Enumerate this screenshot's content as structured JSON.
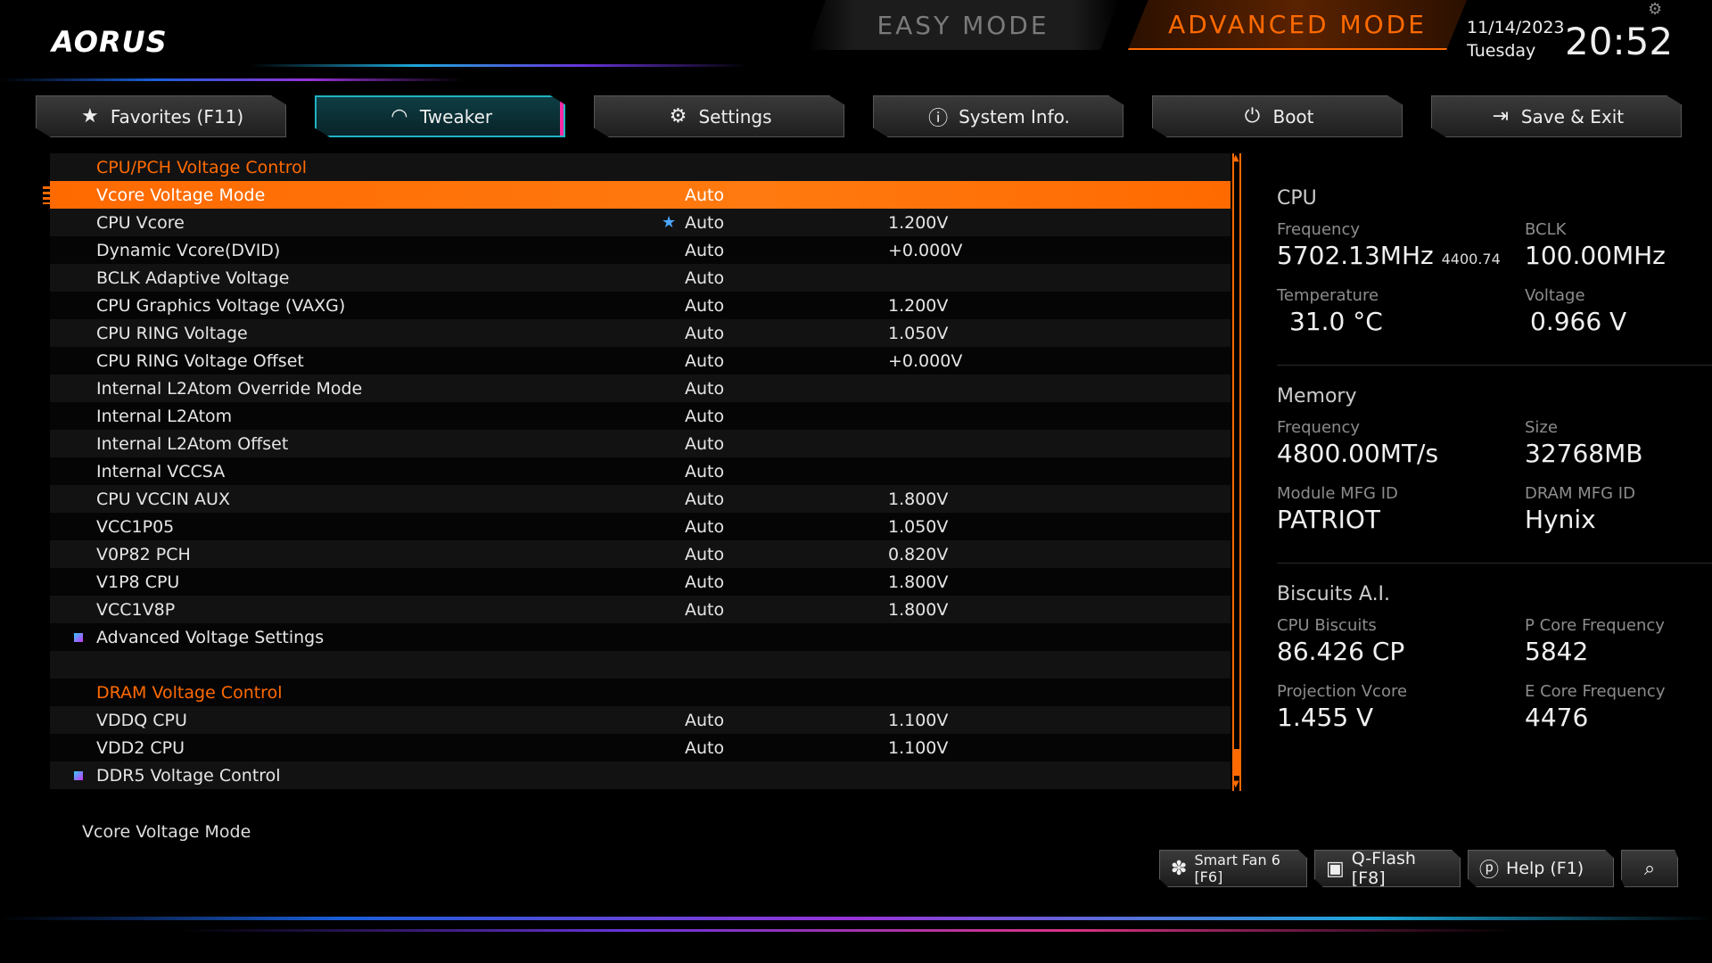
{
  "header": {
    "logo": "AORUS",
    "easy_mode": "EASY MODE",
    "advanced_mode": "ADVANCED MODE",
    "date": "11/14/2023",
    "day": "Tuesday",
    "time": "20:52"
  },
  "tabs": [
    {
      "label": "Favorites (F11)",
      "icon": "star-icon"
    },
    {
      "label": "Tweaker",
      "icon": "speedometer-icon"
    },
    {
      "label": "Settings",
      "icon": "gear-icon"
    },
    {
      "label": "System Info.",
      "icon": "info-icon"
    },
    {
      "label": "Boot",
      "icon": "power-icon"
    },
    {
      "label": "Save & Exit",
      "icon": "exit-icon"
    }
  ],
  "rows": [
    {
      "name": "CPU/PCH Voltage Control",
      "val1": "",
      "val2": ""
    },
    {
      "name": "Vcore Voltage Mode",
      "val1": "Auto",
      "val2": ""
    },
    {
      "name": "CPU Vcore",
      "val1": "Auto",
      "val2": "1.200V"
    },
    {
      "name": "Dynamic Vcore(DVID)",
      "val1": "Auto",
      "val2": "+0.000V"
    },
    {
      "name": "BCLK Adaptive Voltage",
      "val1": "Auto",
      "val2": ""
    },
    {
      "name": "CPU Graphics Voltage (VAXG)",
      "val1": "Auto",
      "val2": "1.200V"
    },
    {
      "name": "CPU RING Voltage",
      "val1": "Auto",
      "val2": "1.050V"
    },
    {
      "name": "CPU RING Voltage Offset",
      "val1": "Auto",
      "val2": "+0.000V"
    },
    {
      "name": "Internal L2Atom Override Mode",
      "val1": "Auto",
      "val2": ""
    },
    {
      "name": "Internal L2Atom",
      "val1": "Auto",
      "val2": ""
    },
    {
      "name": "Internal L2Atom Offset",
      "val1": "Auto",
      "val2": ""
    },
    {
      "name": "Internal VCCSA",
      "val1": "Auto",
      "val2": ""
    },
    {
      "name": "CPU VCCIN AUX",
      "val1": "Auto",
      "val2": "1.800V"
    },
    {
      "name": "VCC1P05",
      "val1": "Auto",
      "val2": "1.050V"
    },
    {
      "name": "V0P82 PCH",
      "val1": "Auto",
      "val2": "0.820V"
    },
    {
      "name": "V1P8 CPU",
      "val1": "Auto",
      "val2": "1.800V"
    },
    {
      "name": "VCC1V8P",
      "val1": "Auto",
      "val2": "1.800V"
    },
    {
      "name": "Advanced Voltage Settings",
      "val1": "",
      "val2": ""
    },
    {
      "name": "",
      "val1": "",
      "val2": ""
    },
    {
      "name": "DRAM Voltage Control",
      "val1": "",
      "val2": ""
    },
    {
      "name": "VDDQ CPU",
      "val1": "Auto",
      "val2": "1.100V"
    },
    {
      "name": "VDD2 CPU",
      "val1": "Auto",
      "val2": "1.100V"
    },
    {
      "name": "DDR5 Voltage Control",
      "val1": "",
      "val2": ""
    }
  ],
  "info": {
    "cpu": {
      "title": "CPU",
      "freq_label": "Frequency",
      "freq": "5702.13MHz",
      "freq_sub": "4400.74",
      "bclk_label": "BCLK",
      "bclk": "100.00MHz",
      "temp_label": "Temperature",
      "temp": "31.0 °C",
      "volt_label": "Voltage",
      "volt": "0.966 V"
    },
    "memory": {
      "title": "Memory",
      "freq_label": "Frequency",
      "freq": "4800.00MT/s",
      "size_label": "Size",
      "size": "32768MB",
      "mfg_label": "Module MFG ID",
      "mfg": "PATRIOT",
      "dram_label": "DRAM MFG ID",
      "dram": "Hynix"
    },
    "biscuits": {
      "title": "Biscuits A.I.",
      "cpu_label": "CPU Biscuits",
      "cpu": "86.426 CP",
      "pcore_label": "P Core Frequency",
      "pcore": "5842",
      "proj_label": "Projection Vcore",
      "proj": "1.455 V",
      "ecore_label": "E Core Frequency",
      "ecore": "4476"
    }
  },
  "footer": {
    "help_text": "Vcore Voltage Mode",
    "smart_fan": "Smart Fan 6 [F6]",
    "qflash": "Q-Flash [F8]",
    "help": "Help (F1)"
  },
  "colors": {
    "accent": "#ff6a00",
    "tab_active": "#1fb4c4",
    "magenta": "#ff2aa5"
  }
}
